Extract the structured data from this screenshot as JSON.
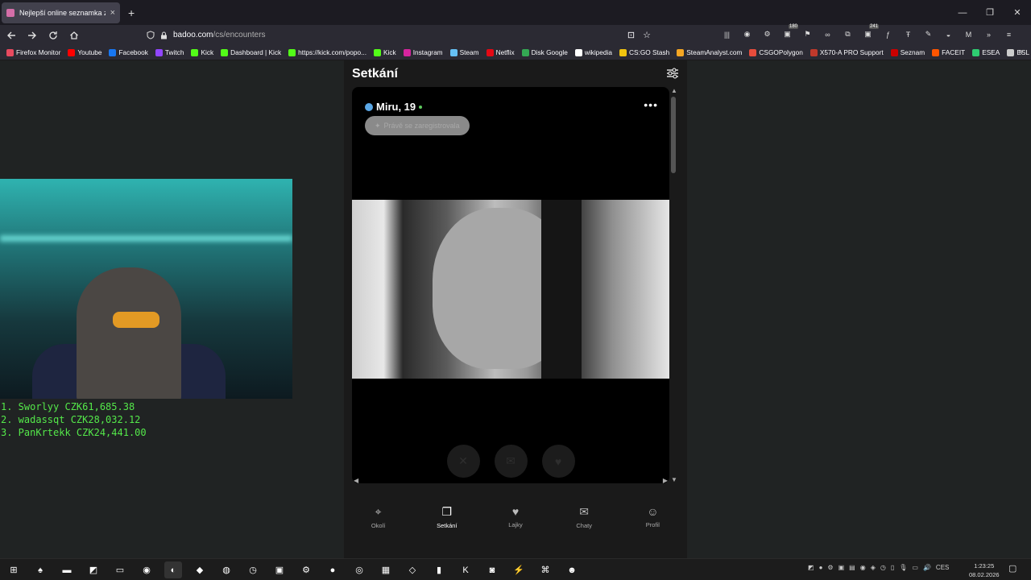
{
  "browser": {
    "tab_title": "Nejlepší online seznamka zdarm",
    "tab_close": "×",
    "new_tab": "+",
    "url_host": "badoo.com",
    "url_path": "/cs/encounters",
    "window_controls": [
      "—",
      "❐",
      "✕"
    ]
  },
  "extensions": [
    {
      "name": "library-icon",
      "glyph": "|||"
    },
    {
      "name": "account-icon",
      "glyph": "◉"
    },
    {
      "name": "steam-ext-icon",
      "glyph": "⚙"
    },
    {
      "name": "ext-180-icon",
      "glyph": "▣",
      "badge": "180"
    },
    {
      "name": "ext-shield-icon",
      "glyph": "⚑"
    },
    {
      "name": "ext-glasses-icon",
      "glyph": "∞"
    },
    {
      "name": "extensions-icon",
      "glyph": "⧉"
    },
    {
      "name": "ext-241-icon",
      "glyph": "▣",
      "badge": "241"
    },
    {
      "name": "ext-f-icon",
      "glyph": "ƒ"
    },
    {
      "name": "ext-t-icon",
      "glyph": "Ŧ"
    },
    {
      "name": "ext-pen-icon",
      "glyph": "✎"
    },
    {
      "name": "ext-cheese-icon",
      "glyph": "◒"
    },
    {
      "name": "ext-m-icon",
      "glyph": "M"
    },
    {
      "name": "overflow-icon",
      "glyph": "»"
    },
    {
      "name": "menu-icon",
      "glyph": "≡"
    }
  ],
  "bookmarks": [
    {
      "label": "Firefox Monitor",
      "color": "#e84a5f"
    },
    {
      "label": "Youtube",
      "color": "#ff0000"
    },
    {
      "label": "Facebook",
      "color": "#1877f2"
    },
    {
      "label": "Twitch",
      "color": "#9146ff"
    },
    {
      "label": "Kick",
      "color": "#53fc18"
    },
    {
      "label": "Dashboard | Kick",
      "color": "#53fc18"
    },
    {
      "label": "https://kick.com/popo...",
      "color": "#53fc18"
    },
    {
      "label": "Kick",
      "color": "#53fc18"
    },
    {
      "label": "Instagram",
      "color": "#d6249f"
    },
    {
      "label": "Steam",
      "color": "#66c0f4"
    },
    {
      "label": "Netflix",
      "color": "#e50914"
    },
    {
      "label": "Disk Google",
      "color": "#34a853"
    },
    {
      "label": "wikipedia",
      "color": "#ffffff"
    },
    {
      "label": "CS:GO Stash",
      "color": "#f1c40f"
    },
    {
      "label": "SteamAnalyst.com",
      "color": "#f5a623"
    },
    {
      "label": "CSGOPolygon",
      "color": "#e74c3c"
    },
    {
      "label": "X570-A PRO Support",
      "color": "#c0392b"
    },
    {
      "label": "Seznam",
      "color": "#cc0000"
    },
    {
      "label": "FACEIT",
      "color": "#ff5500"
    },
    {
      "label": "ESEA",
      "color": "#2ecc71"
    },
    {
      "label": "ESL",
      "color": "#cccccc"
    }
  ],
  "leaderboard": [
    "1. Sworlyy CZK61,685.38",
    "2. wadassqt CZK28,032.12",
    "3. PanKrtekk CZK24,441.00"
  ],
  "app": {
    "title": "Setkání",
    "profile_name": "Miru, 19",
    "badge_text": "Právě se zaregistrovala",
    "more": "•••",
    "actions": [
      {
        "name": "dislike-button",
        "glyph": "✕"
      },
      {
        "name": "message-button",
        "glyph": "✉"
      },
      {
        "name": "like-button",
        "glyph": "♥"
      }
    ],
    "nav": [
      {
        "name": "nav-okoli",
        "label": "Okolí",
        "glyph": "⌖",
        "active": false
      },
      {
        "name": "nav-setkani",
        "label": "Setkání",
        "glyph": "❐",
        "active": true
      },
      {
        "name": "nav-lajky",
        "label": "Lajky",
        "glyph": "♥",
        "active": false
      },
      {
        "name": "nav-chaty",
        "label": "Chaty",
        "glyph": "✉",
        "active": false
      },
      {
        "name": "nav-profil",
        "label": "Profil",
        "glyph": "☺",
        "active": false
      }
    ]
  },
  "taskbar": {
    "apps": [
      {
        "name": "start-icon",
        "glyph": "⊞"
      },
      {
        "name": "app-icon-1",
        "glyph": "♠"
      },
      {
        "name": "file-explorer-icon",
        "glyph": "▬"
      },
      {
        "name": "nvidia-icon",
        "glyph": "◩"
      },
      {
        "name": "terminal-icon",
        "glyph": "▭"
      },
      {
        "name": "spotify-icon",
        "glyph": "◉"
      },
      {
        "name": "firefox-icon",
        "glyph": "◐",
        "active": true
      },
      {
        "name": "app-icon-2",
        "glyph": "◆"
      },
      {
        "name": "app-icon-3",
        "glyph": "◍"
      },
      {
        "name": "clock-app-icon",
        "glyph": "◷"
      },
      {
        "name": "monitor-icon",
        "glyph": "▣"
      },
      {
        "name": "steam-icon",
        "glyph": "⚙"
      },
      {
        "name": "app-icon-4",
        "glyph": "●"
      },
      {
        "name": "csgo-icon",
        "glyph": "◎"
      },
      {
        "name": "calculator-icon",
        "glyph": "▦"
      },
      {
        "name": "app-icon-5",
        "glyph": "◇"
      },
      {
        "name": "app-icon-6",
        "glyph": "▮"
      },
      {
        "name": "kick-icon",
        "glyph": "K"
      },
      {
        "name": "app-icon-7",
        "glyph": "◙"
      },
      {
        "name": "app-icon-8",
        "glyph": "⚡"
      },
      {
        "name": "app-icon-9",
        "glyph": "⌘"
      },
      {
        "name": "discord-icon",
        "glyph": "☻"
      }
    ],
    "language": "CES",
    "time": "1:23:25",
    "date": "08.02.2026"
  }
}
